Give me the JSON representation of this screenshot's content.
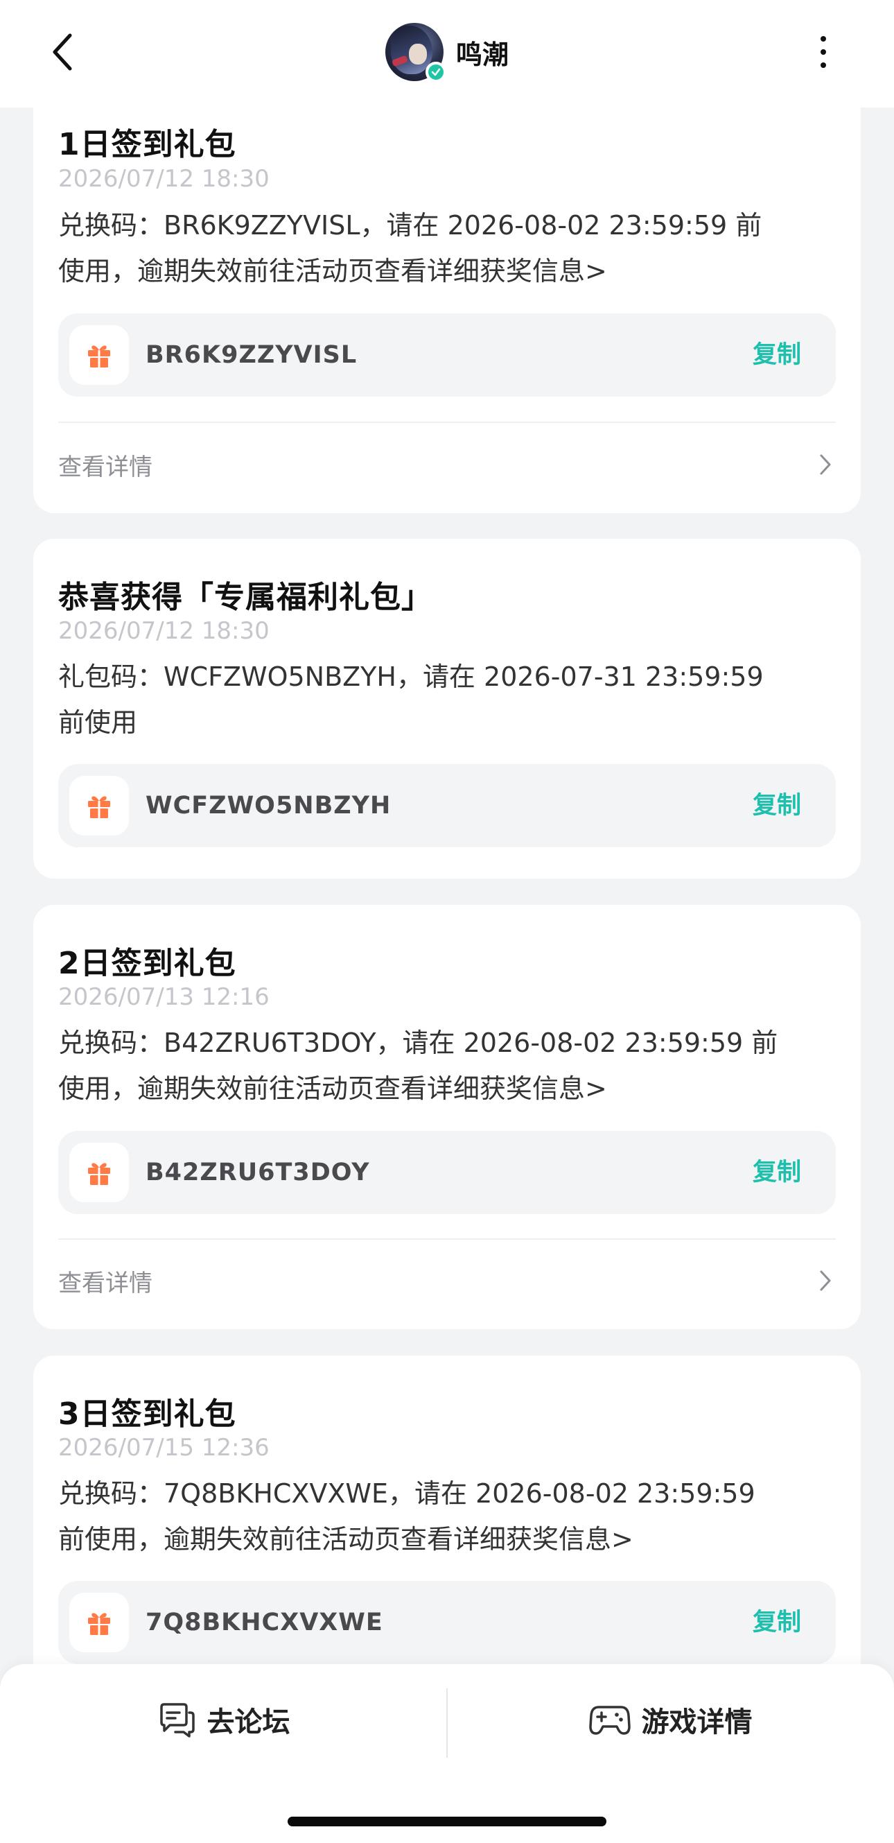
{
  "header": {
    "back_icon": "chevron-left-icon",
    "app_name": "鸣潮",
    "avatar_icon": "avatar-image",
    "verified_icon": "check-badge-icon",
    "more_icon": "vertical-ellipsis-icon"
  },
  "colors": {
    "accent": "#1fbfae",
    "gift": "#ff7a45",
    "verified": "#20c5a6",
    "background": "#f2f3f5"
  },
  "cards": [
    {
      "title": "1日签到礼包",
      "time": "2026/07/12 18:30",
      "desc_line1": "兑换码：BR6K9ZZYVISL，请在 2026-08-02 23:59:59 前",
      "desc_line2": "使用，逾期失效前往活动页查看详细获奖信息>",
      "code": "BR6K9ZZYVISL",
      "copy_label": "复制",
      "detail_label": "查看详情"
    },
    {
      "title": "恭喜获得「专属福利礼包」",
      "time": "2026/07/12 18:30",
      "desc_line1": "礼包码：WCFZWO5NBZYH，请在 2026-07-31 23:59:59",
      "desc_line2": "前使用",
      "code": "WCFZWO5NBZYH",
      "copy_label": "复制"
    },
    {
      "title": "2日签到礼包",
      "time": "2026/07/13 12:16",
      "desc_line1": "兑换码：B42ZRU6T3DOY，请在 2026-08-02 23:59:59 前",
      "desc_line2": "使用，逾期失效前往活动页查看详细获奖信息>",
      "code": "B42ZRU6T3DOY",
      "copy_label": "复制",
      "detail_label": "查看详情"
    },
    {
      "title": "3日签到礼包",
      "time": "2026/07/15 12:36",
      "desc_line1": "兑换码：7Q8BKHCXVXWE，请在 2026-08-02 23:59:59",
      "desc_line2": "前使用，逾期失效前往活动页查看详细获奖信息>",
      "code": "7Q8BKHCXVXWE",
      "copy_label": "复制"
    }
  ],
  "bottom_bar": {
    "forum_label": "去论坛",
    "forum_icon": "chat-bubble-icon",
    "game_label": "游戏详情",
    "game_icon": "gamepad-icon"
  }
}
